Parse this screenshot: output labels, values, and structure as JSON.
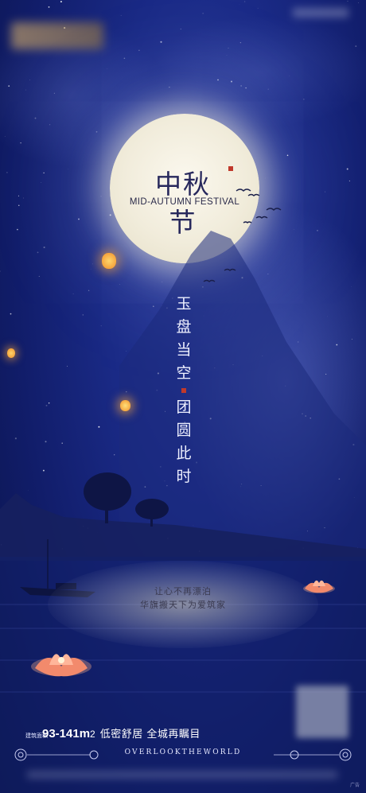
{
  "moon": {
    "title": "中秋节",
    "subtitle": "MID-AUTUMN FESTIVAL"
  },
  "poem": {
    "line1": [
      "玉",
      "盘",
      "当",
      "空"
    ],
    "line2": [
      "团",
      "圆",
      "此",
      "时"
    ]
  },
  "slogan": {
    "line1": "让心不再漂泊",
    "line2": "华旗搬天下为爱筑家"
  },
  "bottom": {
    "area_label": "建筑面积",
    "area_value": "93-141m",
    "area_unit": "2",
    "tagline": "低密舒居 全城再瞩目",
    "overlook": "OVERLOOKTHEWORLD"
  },
  "ad_tag": "广告",
  "colors": {
    "sky": "#1a2a86",
    "moon": "#f1ecdb",
    "seal": "#c0392b",
    "lantern": "#f5a623",
    "lotus": "#f28a6c"
  }
}
